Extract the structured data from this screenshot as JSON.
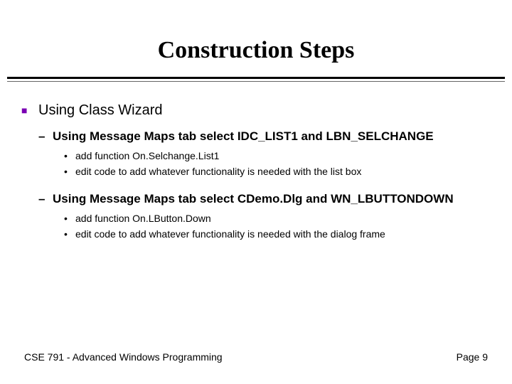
{
  "title": "Construction Steps",
  "l1": "Using Class Wizard",
  "l2a": "Using Message Maps tab select IDC_LIST1 and LBN_SELCHANGE",
  "l3a1": "add function On.Selchange.List1",
  "l3a2": "edit code to add whatever functionality is needed with the list box",
  "l2b": "Using Message Maps tab select CDemo.Dlg and WN_LBUTTONDOWN",
  "l3b1": "add function On.LButton.Down",
  "l3b2": "edit code to add whatever functionality is needed with the dialog frame",
  "footer_left": "CSE 791 - Advanced Windows Programming",
  "footer_right": "Page 9"
}
